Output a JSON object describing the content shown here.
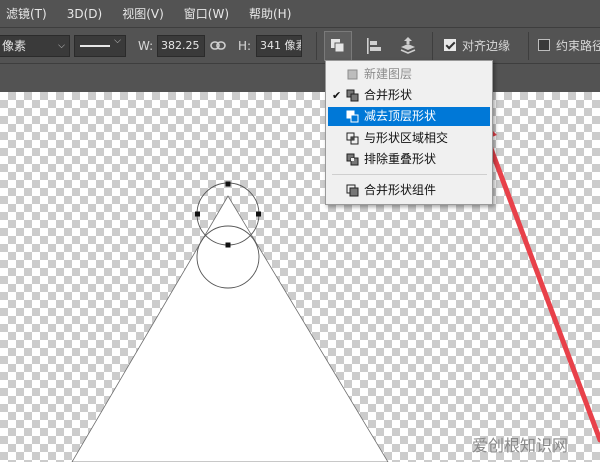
{
  "menubar": {
    "items": [
      "滤镜(T)",
      "3D(D)",
      "视图(V)",
      "窗口(W)",
      "帮助(H)"
    ]
  },
  "options": {
    "unit_value": "像素",
    "w_label": "W:",
    "w_value": "382.25 |",
    "h_label": "H:",
    "h_value": "341 像素",
    "align_edges_label": "对齐边缘",
    "align_edges_checked": true,
    "constrain_label": "约束路径",
    "constrain_checked": false
  },
  "path_ops_menu": {
    "items": [
      {
        "label": "新建图层",
        "icon": "new-layer-icon",
        "checked": false,
        "disabled": true,
        "active": false
      },
      {
        "label": "合并形状",
        "icon": "combine-shapes-icon",
        "checked": true,
        "disabled": false,
        "active": false
      },
      {
        "label": "减去顶层形状",
        "icon": "subtract-front-shape-icon",
        "checked": false,
        "disabled": false,
        "active": true
      },
      {
        "label": "与形状区域相交",
        "icon": "intersect-shape-areas-icon",
        "checked": false,
        "disabled": false,
        "active": false
      },
      {
        "label": "排除重叠形状",
        "icon": "exclude-overlapping-shapes-icon",
        "checked": false,
        "disabled": false,
        "active": false
      },
      {
        "label": "合并形状组件",
        "icon": "merge-shape-components-icon",
        "checked": false,
        "disabled": false,
        "active": false
      }
    ],
    "checkmark": "✔"
  },
  "colors": {
    "highlight": "#0078d7",
    "annotation_arrow": "#e8414a",
    "ui_background": "#535353"
  },
  "watermark": "爱创根知识网"
}
